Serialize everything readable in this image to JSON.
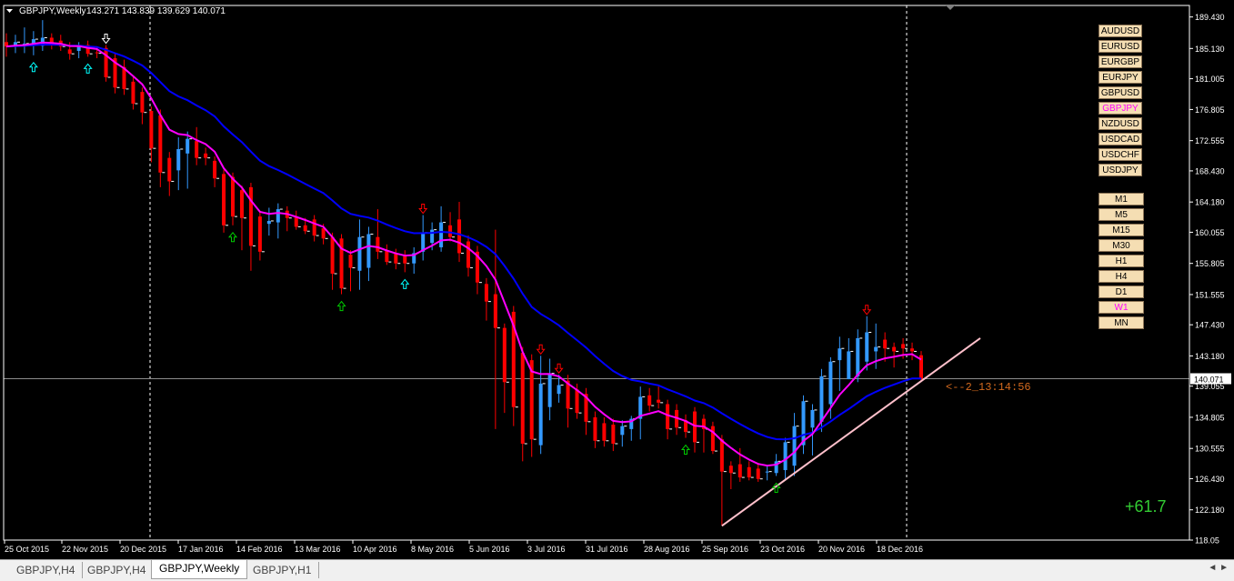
{
  "chart_data": {
    "type": "candlestick",
    "title": "GBPJPY,Weekly",
    "ohlc_label": "143.271 143.839 139.629 140.071",
    "ylim": [
      118.05,
      191.0
    ],
    "ytick_labels": [
      "189.430",
      "185.130",
      "181.005",
      "176.805",
      "172.555",
      "168.430",
      "164.180",
      "160.055",
      "155.805",
      "151.555",
      "147.430",
      "143.180",
      "139.055",
      "134.805",
      "130.555",
      "126.430",
      "122.180",
      "118.05"
    ],
    "ytick_values": [
      189.43,
      185.13,
      181.005,
      176.805,
      172.555,
      168.43,
      164.18,
      160.055,
      155.805,
      151.555,
      147.43,
      143.18,
      139.055,
      134.805,
      130.555,
      126.43,
      122.18,
      118.05
    ],
    "xtick_labels": [
      "25 Oct 2015",
      "22 Nov 2015",
      "20 Dec 2015",
      "17 Jan 2016",
      "14 Feb 2016",
      "13 Mar 2016",
      "10 Apr 2016",
      "8 May 2016",
      "5 Jun 2016",
      "3 Jul 2016",
      "31 Jul 2016",
      "28 Aug 2016",
      "25 Sep 2016",
      "23 Oct 2016",
      "20 Nov 2016",
      "18 Dec 2016"
    ],
    "current_price": "140.071",
    "current_price_value": 140.071,
    "countdown": "<--2_13:14:56",
    "pnl": "+61.7",
    "candles": [
      {
        "o": 186.0,
        "h": 187.2,
        "l": 184.0,
        "c": 185.4
      },
      {
        "o": 185.4,
        "h": 187.0,
        "l": 184.5,
        "c": 186.0
      },
      {
        "o": 185.5,
        "h": 188.0,
        "l": 184.5,
        "c": 185.8
      },
      {
        "o": 185.8,
        "h": 187.5,
        "l": 184.2,
        "c": 186.4
      },
      {
        "o": 185.5,
        "h": 189.0,
        "l": 184.8,
        "c": 186.6
      },
      {
        "o": 186.6,
        "h": 187.2,
        "l": 185.0,
        "c": 185.6
      },
      {
        "o": 186.2,
        "h": 187.0,
        "l": 184.8,
        "c": 185.4
      },
      {
        "o": 185.0,
        "h": 186.0,
        "l": 183.6,
        "c": 184.4
      },
      {
        "o": 184.8,
        "h": 186.0,
        "l": 183.8,
        "c": 185.4
      },
      {
        "o": 185.6,
        "h": 186.2,
        "l": 184.0,
        "c": 184.4
      },
      {
        "o": 184.6,
        "h": 185.4,
        "l": 183.8,
        "c": 184.5
      },
      {
        "o": 185.2,
        "h": 185.6,
        "l": 180.6,
        "c": 181.2
      },
      {
        "o": 183.8,
        "h": 184.5,
        "l": 179.0,
        "c": 179.8
      },
      {
        "o": 182.6,
        "h": 183.6,
        "l": 178.8,
        "c": 179.6
      },
      {
        "o": 180.6,
        "h": 181.2,
        "l": 176.8,
        "c": 177.6
      },
      {
        "o": 179.2,
        "h": 179.8,
        "l": 174.8,
        "c": 176.4
      },
      {
        "o": 176.6,
        "h": 177.2,
        "l": 169.6,
        "c": 171.5
      },
      {
        "o": 176.0,
        "h": 176.8,
        "l": 166.2,
        "c": 168.2
      },
      {
        "o": 170.2,
        "h": 171.0,
        "l": 165.0,
        "c": 167.0
      },
      {
        "o": 168.5,
        "h": 173.0,
        "l": 165.8,
        "c": 171.4
      },
      {
        "o": 170.8,
        "h": 173.8,
        "l": 166.0,
        "c": 172.8
      },
      {
        "o": 172.5,
        "h": 174.4,
        "l": 169.2,
        "c": 170.2
      },
      {
        "o": 170.8,
        "h": 171.6,
        "l": 169.2,
        "c": 170.2
      },
      {
        "o": 169.8,
        "h": 170.4,
        "l": 166.2,
        "c": 167.4
      },
      {
        "o": 168.0,
        "h": 168.6,
        "l": 160.0,
        "c": 161.0
      },
      {
        "o": 167.6,
        "h": 168.2,
        "l": 161.0,
        "c": 162.2
      },
      {
        "o": 165.8,
        "h": 166.4,
        "l": 157.6,
        "c": 162.0
      },
      {
        "o": 166.2,
        "h": 166.8,
        "l": 154.8,
        "c": 158.2
      },
      {
        "o": 162.2,
        "h": 163.0,
        "l": 156.2,
        "c": 157.4
      },
      {
        "o": 161.2,
        "h": 163.4,
        "l": 159.6,
        "c": 161.6
      },
      {
        "o": 161.4,
        "h": 164.0,
        "l": 159.2,
        "c": 163.2
      },
      {
        "o": 163.0,
        "h": 163.6,
        "l": 160.2,
        "c": 162.0
      },
      {
        "o": 162.2,
        "h": 163.0,
        "l": 160.4,
        "c": 160.8
      },
      {
        "o": 161.0,
        "h": 162.0,
        "l": 159.8,
        "c": 160.2
      },
      {
        "o": 161.8,
        "h": 162.4,
        "l": 158.8,
        "c": 159.6
      },
      {
        "o": 160.6,
        "h": 161.2,
        "l": 158.4,
        "c": 159.2
      },
      {
        "o": 159.4,
        "h": 160.0,
        "l": 152.2,
        "c": 154.4
      },
      {
        "o": 159.2,
        "h": 159.8,
        "l": 151.6,
        "c": 152.4
      },
      {
        "o": 157.0,
        "h": 157.6,
        "l": 152.0,
        "c": 155.2
      },
      {
        "o": 154.8,
        "h": 161.8,
        "l": 152.2,
        "c": 159.4
      },
      {
        "o": 155.2,
        "h": 160.8,
        "l": 153.4,
        "c": 159.8
      },
      {
        "o": 159.4,
        "h": 163.2,
        "l": 156.4,
        "c": 157.4
      },
      {
        "o": 157.6,
        "h": 158.4,
        "l": 155.6,
        "c": 156.0
      },
      {
        "o": 157.2,
        "h": 157.8,
        "l": 155.0,
        "c": 155.8
      },
      {
        "o": 156.8,
        "h": 157.6,
        "l": 154.6,
        "c": 155.8
      },
      {
        "o": 155.8,
        "h": 158.0,
        "l": 154.4,
        "c": 157.2
      },
      {
        "o": 157.4,
        "h": 162.4,
        "l": 156.2,
        "c": 160.0
      },
      {
        "o": 158.6,
        "h": 161.4,
        "l": 157.6,
        "c": 160.4
      },
      {
        "o": 158.0,
        "h": 163.6,
        "l": 157.4,
        "c": 161.4
      },
      {
        "o": 161.0,
        "h": 162.8,
        "l": 158.8,
        "c": 159.4
      },
      {
        "o": 161.8,
        "h": 164.2,
        "l": 156.0,
        "c": 157.2
      },
      {
        "o": 158.8,
        "h": 159.6,
        "l": 154.0,
        "c": 155.2
      },
      {
        "o": 157.4,
        "h": 158.2,
        "l": 151.6,
        "c": 153.2
      },
      {
        "o": 153.0,
        "h": 153.8,
        "l": 148.0,
        "c": 150.6
      },
      {
        "o": 151.6,
        "h": 160.4,
        "l": 133.2,
        "c": 147.0
      },
      {
        "o": 147.0,
        "h": 147.6,
        "l": 135.4,
        "c": 139.6
      },
      {
        "o": 149.2,
        "h": 150.0,
        "l": 133.6,
        "c": 136.2
      },
      {
        "o": 143.6,
        "h": 144.4,
        "l": 128.8,
        "c": 131.2
      },
      {
        "o": 142.6,
        "h": 143.4,
        "l": 129.4,
        "c": 131.8
      },
      {
        "o": 131.0,
        "h": 143.2,
        "l": 129.8,
        "c": 139.4
      },
      {
        "o": 136.2,
        "h": 142.8,
        "l": 134.4,
        "c": 140.8
      },
      {
        "o": 138.0,
        "h": 140.6,
        "l": 136.8,
        "c": 139.2
      },
      {
        "o": 139.8,
        "h": 140.6,
        "l": 133.4,
        "c": 136.0
      },
      {
        "o": 138.6,
        "h": 139.4,
        "l": 134.6,
        "c": 135.4
      },
      {
        "o": 138.0,
        "h": 138.8,
        "l": 132.4,
        "c": 134.2
      },
      {
        "o": 134.8,
        "h": 135.6,
        "l": 130.6,
        "c": 131.6
      },
      {
        "o": 134.0,
        "h": 134.8,
        "l": 130.8,
        "c": 131.6
      },
      {
        "o": 133.8,
        "h": 134.6,
        "l": 130.2,
        "c": 131.2
      },
      {
        "o": 132.4,
        "h": 134.4,
        "l": 130.8,
        "c": 133.6
      },
      {
        "o": 133.2,
        "h": 135.0,
        "l": 131.6,
        "c": 134.6
      },
      {
        "o": 134.6,
        "h": 139.0,
        "l": 131.8,
        "c": 137.6
      },
      {
        "o": 137.8,
        "h": 138.8,
        "l": 135.6,
        "c": 136.4
      },
      {
        "o": 137.2,
        "h": 139.0,
        "l": 136.0,
        "c": 136.8
      },
      {
        "o": 136.6,
        "h": 137.2,
        "l": 131.8,
        "c": 133.2
      },
      {
        "o": 135.8,
        "h": 136.6,
        "l": 132.4,
        "c": 133.4
      },
      {
        "o": 134.4,
        "h": 135.2,
        "l": 132.0,
        "c": 132.8
      },
      {
        "o": 135.6,
        "h": 136.2,
        "l": 130.0,
        "c": 131.4
      },
      {
        "o": 134.6,
        "h": 135.2,
        "l": 130.0,
        "c": 133.2
      },
      {
        "o": 133.6,
        "h": 134.2,
        "l": 129.8,
        "c": 130.2
      },
      {
        "o": 131.8,
        "h": 132.4,
        "l": 120.0,
        "c": 127.4
      },
      {
        "o": 128.2,
        "h": 128.8,
        "l": 125.0,
        "c": 127.2
      },
      {
        "o": 128.4,
        "h": 130.6,
        "l": 126.0,
        "c": 126.6
      },
      {
        "o": 128.0,
        "h": 128.8,
        "l": 126.2,
        "c": 126.6
      },
      {
        "o": 127.8,
        "h": 128.6,
        "l": 126.0,
        "c": 126.4
      },
      {
        "o": 127.4,
        "h": 128.2,
        "l": 126.2,
        "c": 127.4
      },
      {
        "o": 127.2,
        "h": 129.8,
        "l": 126.8,
        "c": 128.8
      },
      {
        "o": 127.6,
        "h": 132.0,
        "l": 126.2,
        "c": 131.4
      },
      {
        "o": 128.2,
        "h": 135.4,
        "l": 126.8,
        "c": 133.6
      },
      {
        "o": 131.0,
        "h": 137.8,
        "l": 129.8,
        "c": 137.0
      },
      {
        "o": 133.4,
        "h": 136.6,
        "l": 129.6,
        "c": 135.8
      },
      {
        "o": 134.2,
        "h": 141.4,
        "l": 132.8,
        "c": 140.4
      },
      {
        "o": 136.6,
        "h": 143.0,
        "l": 134.6,
        "c": 142.4
      },
      {
        "o": 142.6,
        "h": 145.8,
        "l": 138.4,
        "c": 144.2
      },
      {
        "o": 140.0,
        "h": 145.6,
        "l": 140.0,
        "c": 143.8
      },
      {
        "o": 140.4,
        "h": 146.8,
        "l": 139.6,
        "c": 145.6
      },
      {
        "o": 142.4,
        "h": 148.6,
        "l": 141.2,
        "c": 146.4
      },
      {
        "o": 143.8,
        "h": 147.6,
        "l": 141.4,
        "c": 144.4
      },
      {
        "o": 145.4,
        "h": 146.4,
        "l": 142.4,
        "c": 144.2
      },
      {
        "o": 144.4,
        "h": 145.0,
        "l": 141.6,
        "c": 143.8
      },
      {
        "o": 144.8,
        "h": 145.6,
        "l": 142.8,
        "c": 144.2
      },
      {
        "o": 144.2,
        "h": 145.0,
        "l": 142.6,
        "c": 143.8
      },
      {
        "o": 143.271,
        "h": 143.839,
        "l": 139.629,
        "c": 140.071
      }
    ]
  },
  "symbols": [
    "AUDUSD",
    "EURUSD",
    "EURGBP",
    "EURJPY",
    "GBPUSD",
    "GBPJPY",
    "NZDUSD",
    "USDCAD",
    "USDCHF",
    "USDJPY"
  ],
  "active_symbol": "GBPJPY",
  "timeframes": [
    "M1",
    "M5",
    "M15",
    "M30",
    "H1",
    "H4",
    "D1",
    "W1",
    "MN"
  ],
  "active_timeframe": "W1",
  "tabs": [
    {
      "label": "GBPJPY,H4",
      "active": false
    },
    {
      "label": "GBPJPY,H4",
      "active": false
    },
    {
      "label": "GBPJPY,Weekly",
      "active": true
    },
    {
      "label": "GBPJPY,H1",
      "active": false
    }
  ],
  "colors": {
    "bull": "#3399ff",
    "bear": "#ff0000",
    "ma_fast": "#ff00ff",
    "ma_slow": "#0000ff",
    "trendline": "#ffc0cb",
    "grid": "#ffffff",
    "pnl": "#33cc33",
    "countdown": "#d2691e"
  }
}
